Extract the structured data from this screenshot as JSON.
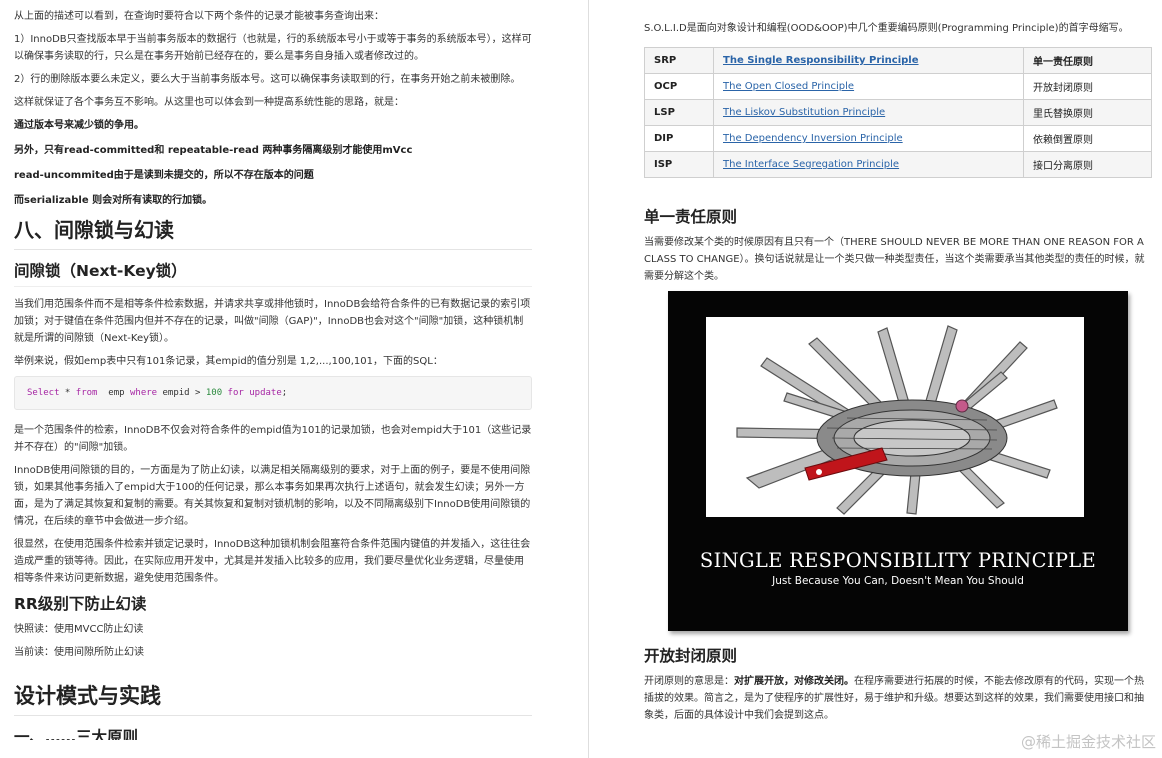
{
  "left": {
    "p1": "从上面的描述可以看到，在查询时要符合以下两个条件的记录才能被事务查询出来：",
    "p2": "1）InnoDB只查找版本早于当前事务版本的数据行（也就是，行的系统版本号小于或等于事务的系统版本号），这样可以确保事务读取的行，只么是在事务开始前已经存在的，要么是事务自身插入或者修改过的。",
    "p3": "2）行的删除版本要么未定义，要么大于当前事务版本号。这可以确保事务读取到的行，在事务开始之前未被删除。",
    "p4": "这样就保证了各个事务互不影响。从这里也可以体会到一种提高系统性能的思路，就是：",
    "b1": "通过版本号来减少锁的争用。",
    "b2": "另外，只有read-committed和 repeatable-read 两种事务隔离级别才能使用mVcc",
    "b3": "read-uncommited由于是读到未提交的，所以不存在版本的问题",
    "b4": "而serializable 则会对所有读取的行加锁。",
    "h2_gap": "八、间隙锁与幻读",
    "h3_nextkey": "间隙锁（Next-Key锁）",
    "p5": "当我们用范围条件而不是相等条件检索数据，并请求共享或排他锁时，InnoDB会给符合条件的已有数据记录的索引项加锁；对于键值在条件范围内但并不存在的记录，叫做\"间隙（GAP)\"，InnoDB也会对这个\"间隙\"加锁，这种锁机制就是所谓的间隙锁（Next-Key锁）。",
    "p6": "举例来说，假如emp表中只有101条记录，其empid的值分别是 1,2,...,100,101，下面的SQL：",
    "code": {
      "kw_select": "Select",
      "star": " * ",
      "kw_from": "from",
      "table": "  emp ",
      "kw_where": "where",
      "cond": " empid > ",
      "num": "100",
      "sp": " ",
      "kw_for": "for",
      "sp2": " ",
      "kw_update": "update",
      "end": ";"
    },
    "p7": "是一个范围条件的检索，InnoDB不仅会对符合条件的empid值为101的记录加锁，也会对empid大于101（这些记录并不存在）的\"间隙\"加锁。",
    "p8": "InnoDB使用间隙锁的目的，一方面是为了防止幻读，以满足相关隔离级别的要求，对于上面的例子，要是不使用间隙锁，如果其他事务插入了empid大于100的任何记录，那么本事务如果再次执行上述语句，就会发生幻读；另外一方面，是为了满足其恢复和复制的需要。有关其恢复和复制对锁机制的影响，以及不同隔离级别下InnoDB使用间隙锁的情况，在后续的章节中会做进一步介绍。",
    "p9": "很显然，在使用范围条件检索并锁定记录时，InnoDB这种加锁机制会阻塞符合条件范围内键值的并发插入，这往往会造成严重的锁等待。因此，在实际应用开发中，尤其是并发插入比较多的应用，我们要尽量优化业务逻辑，尽量使用相等条件来访问更新数据，避免使用范围条件。",
    "h3_rr": "RR级别下防止幻读",
    "p10": "快照读：使用MVCC防止幻读",
    "p11": "当前读：使用间隙所防止幻读",
    "h2_design": "设计模式与实践",
    "h3_clip": "一、……三大原则"
  },
  "right": {
    "intro": "S.O.L.I.D是面向对象设计和编程(OOD&OOP)中几个重要编码原则(Programming Principle)的首字母缩写。",
    "table": [
      {
        "abbr": "SRP",
        "name": "The Single Responsibility Principle",
        "zh": "单一责任原则"
      },
      {
        "abbr": "OCP",
        "name": "The Open Closed Principle",
        "zh": "开放封闭原则"
      },
      {
        "abbr": "LSP",
        "name": "The Liskov Substitution Principle",
        "zh": "里氏替换原则"
      },
      {
        "abbr": "DIP",
        "name": "The Dependency Inversion Principle",
        "zh": "依赖倒置原则"
      },
      {
        "abbr": "ISP",
        "name": "The Interface Segregation Principle",
        "zh": "接口分离原则"
      }
    ],
    "h_srp": "单一责任原则",
    "p_srp": "当需要修改某个类的时候原因有且只有一个（THERE SHOULD NEVER BE MORE THAN ONE REASON FOR A CLASS TO CHANGE）。换句话说就是让一个类只做一种类型责任，当这个类需要承当其他类型的责任的时候，就需要分解这个类。",
    "poster_title": "SINGLE RESPONSIBILITY PRINCIPLE",
    "poster_sub": "Just Because You Can, Doesn't Mean You Should",
    "h_ocp": "开放封闭原则",
    "p_ocp_a": "开闭原则的意思是：",
    "p_ocp_b": "对扩展开放，对修改关闭。",
    "p_ocp_c": "在程序需要进行拓展的时候，不能去修改原有的代码，实现一个热插拔的效果。简言之，是为了使程序的扩展性好，易于维护和升级。想要达到这样的效果，我们需要使用接口和抽象类，后面的具体设计中我们会提到这点。"
  },
  "watermark": "@稀土掘金技术社区"
}
